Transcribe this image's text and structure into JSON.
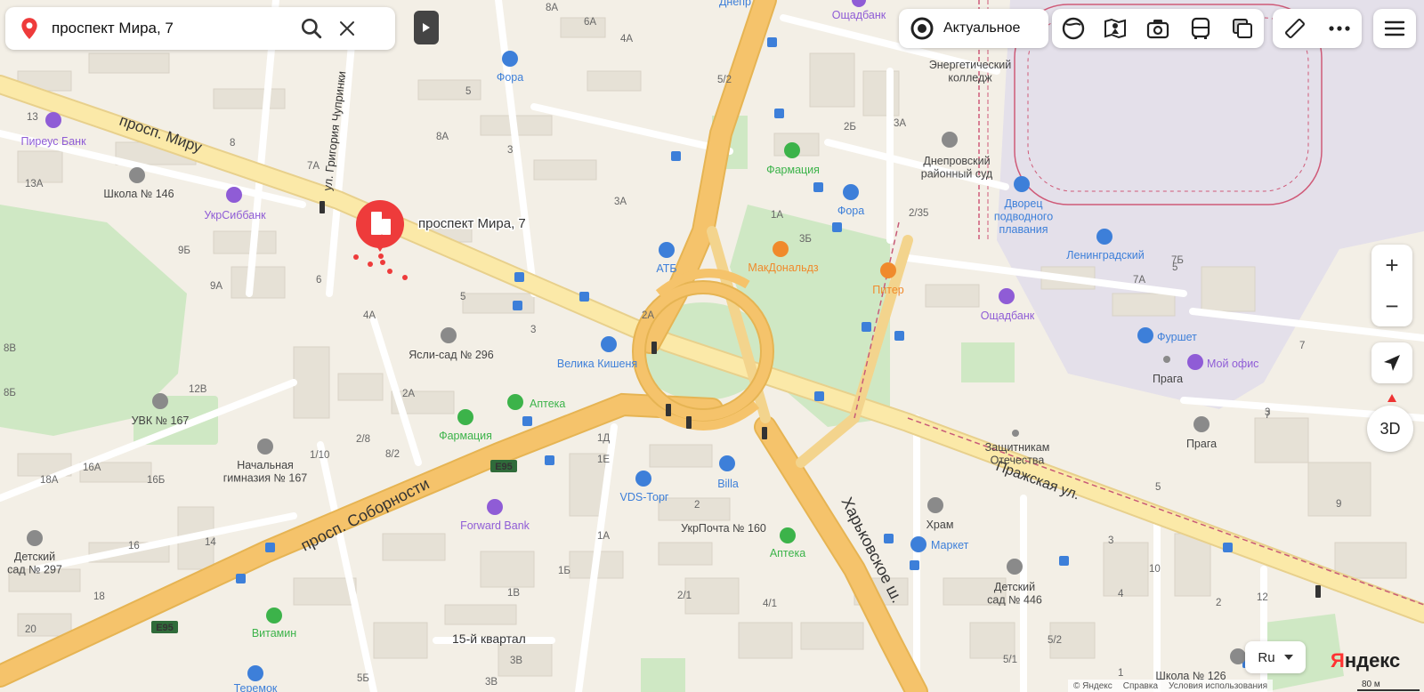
{
  "search": {
    "value": "проспект Мира, 7",
    "search_icon": "search-icon",
    "clear_icon": "close-icon"
  },
  "layer_toggle": {
    "label": "Актуальное"
  },
  "marker": {
    "label": "проспект Мира, 7"
  },
  "controls": {
    "zoom_in": "+",
    "zoom_out": "−",
    "mode_3d": "3D",
    "language": "Ru"
  },
  "brand": {
    "first": "Я",
    "rest": "ндекс"
  },
  "footer": {
    "copyright": "© Яндекс",
    "help": "Справка",
    "terms": "Условия использования"
  },
  "scale": {
    "label": "80 м"
  },
  "colors": {
    "major_road": "#f5c36b",
    "minor_road": "#ffffff",
    "park": "#cfe8c4",
    "block": "#e9e4d9",
    "marker": "#ee3b3b",
    "poi_blue": "#3d7fd9",
    "poi_green": "#3cb34a",
    "poi_orange": "#f08a2c",
    "poi_purple": "#8f5cd6",
    "poi_gray": "#8a8a8a"
  },
  "streets": [
    {
      "text": "просп. Миру"
    },
    {
      "text": "ул. Григория Чупринки"
    },
    {
      "text": "просп. Соборности"
    },
    {
      "text": "Харьковское ш."
    },
    {
      "text": "Пражская ул."
    },
    {
      "text": "E95"
    },
    {
      "text": "E95"
    },
    {
      "text": "15-й квартал"
    }
  ],
  "pois": [
    {
      "text": "Пиреус Банк",
      "kind": "bank"
    },
    {
      "text": "Школа № 146",
      "kind": "school"
    },
    {
      "text": "УкрСиббанк",
      "kind": "bank"
    },
    {
      "text": "Фора",
      "kind": "shop"
    },
    {
      "text": "Днепр",
      "kind": "metro"
    },
    {
      "text": "Ощадбанк",
      "kind": "bank"
    },
    {
      "text": "Энергетический\nколледж",
      "kind": "school"
    },
    {
      "text": "Фармация",
      "kind": "pharmacy"
    },
    {
      "text": "Днепровский\nрайонный суд",
      "kind": "gov"
    },
    {
      "text": "Фора",
      "kind": "shop"
    },
    {
      "text": "Дворец\nподводного\nплавания",
      "kind": "sport"
    },
    {
      "text": "Ленинградский",
      "kind": "shop"
    },
    {
      "text": "АТБ",
      "kind": "shop"
    },
    {
      "text": "МакДональдз",
      "kind": "food"
    },
    {
      "text": "Питер",
      "kind": "food"
    },
    {
      "text": "Ощадбанк",
      "kind": "bank"
    },
    {
      "text": "Фуршет",
      "kind": "shop"
    },
    {
      "text": "Мой офис",
      "kind": "office"
    },
    {
      "text": "Прага",
      "kind": "plain"
    },
    {
      "text": "Ясли-сад № 296",
      "kind": "kinder"
    },
    {
      "text": "Велика Кишеня",
      "kind": "shop"
    },
    {
      "text": "Аптека",
      "kind": "pharmacy"
    },
    {
      "text": "Фармация",
      "kind": "pharmacy"
    },
    {
      "text": "УВК № 167",
      "kind": "school"
    },
    {
      "text": "Начальная\nгимназия № 167",
      "kind": "school"
    },
    {
      "text": "Защитникам\nОтечества",
      "kind": "monument"
    },
    {
      "text": "Прага",
      "kind": "gov"
    },
    {
      "text": "Billa",
      "kind": "shop"
    },
    {
      "text": "VDS-Торг",
      "kind": "car"
    },
    {
      "text": "Forward Bank",
      "kind": "bank"
    },
    {
      "text": "УкрПочта № 160",
      "kind": "plain"
    },
    {
      "text": "Аптека",
      "kind": "pharmacy"
    },
    {
      "text": "Храм",
      "kind": "church"
    },
    {
      "text": "Маркет",
      "kind": "shop"
    },
    {
      "text": "Детский\nсад № 297",
      "kind": "kinder"
    },
    {
      "text": "Детский\nсад № 446",
      "kind": "kinder"
    },
    {
      "text": "Витамин",
      "kind": "pharmacy"
    },
    {
      "text": "Школа № 126",
      "kind": "school"
    },
    {
      "text": "Теремок",
      "kind": "shop"
    }
  ],
  "house_numbers": [
    "13",
    "8",
    "7А",
    "13А",
    "9Б",
    "9А",
    "8В",
    "8Б",
    "12В",
    "18А",
    "16А",
    "16Б",
    "16",
    "14",
    "20",
    "18",
    "6",
    "4А",
    "2А",
    "1/10",
    "2/8",
    "8/2",
    "5",
    "3",
    "2А",
    "8А",
    "3",
    "3А",
    "5",
    "4А",
    "6А",
    "8А",
    "5/2",
    "3А",
    "2Б",
    "2/35",
    "3Б",
    "1А",
    "2А",
    "1Д",
    "1Е",
    "2",
    "1А",
    "1Б",
    "1В",
    "2/1",
    "4/1",
    "3В",
    "3В",
    "5Б",
    "7Б",
    "7А",
    "5",
    "7",
    "9",
    "10",
    "12",
    "5",
    "3",
    "5/2",
    "5/1",
    "4",
    "2",
    "1",
    "7",
    "3",
    "8"
  ]
}
